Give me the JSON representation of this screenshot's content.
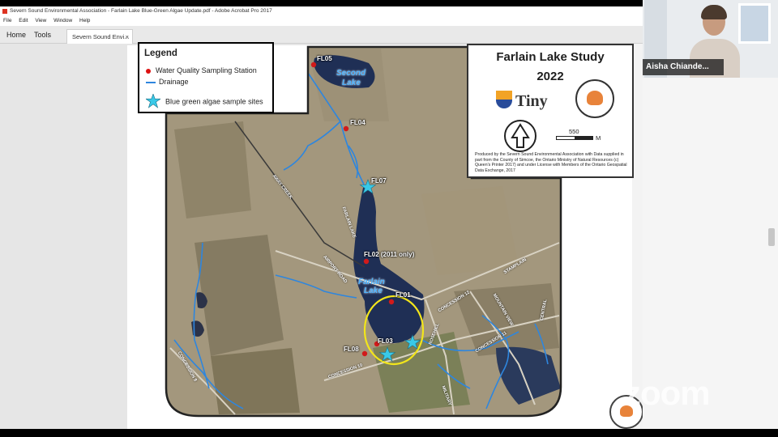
{
  "acrobat": {
    "title": "Severn Sound Environmental Association - Farlain Lake Blue-Green Algae Update.pdf - Adobe Acrobat Pro 2017",
    "menu": [
      "File",
      "Edit",
      "View",
      "Window",
      "Help"
    ],
    "nav": {
      "home": "Home",
      "tools": "Tools"
    },
    "doc_tab": {
      "label": "Severn Sound Envi...",
      "close": "×"
    }
  },
  "map": {
    "legend": {
      "title": "Legend",
      "items": [
        {
          "label": "Water Quality Sampling Station",
          "icon": "red-dot"
        },
        {
          "label": "Drainage",
          "icon": "blue-line"
        },
        {
          "label": "Blue green algae sample sites",
          "icon": "cyan-star"
        }
      ]
    },
    "study": {
      "title": "Farlain Lake Study",
      "year": "2022",
      "logo_text": "Tiny",
      "scale_value": "550",
      "scale_unit": "M",
      "credits": "Produced by the Severn Sound Environmental Association with Data supplied in part from the County of Simcoe, the Ontario Ministry of Natural Resources (c) Queen's Printer 2017) and under License with Members of the Ontario Geospatial Data Exchange, 2017"
    },
    "stations": {
      "fl05": "FL05",
      "fl04": "FL04",
      "fl07": "FL07",
      "fl02": "FL02 (2011 only)",
      "fl01": "FL01",
      "fl03": "FL03",
      "fl08": "FL08"
    },
    "lakes": {
      "second_1": "Second",
      "second_2": "Lake",
      "farlain_1": "Farlain",
      "farlain_2": "Lake"
    },
    "roads": {
      "r1": "AWAY CREEK",
      "r2": "FARLAIN LAKE",
      "r3": "AIRPORT ROAD",
      "r4": "CONCESSION 12",
      "r5": "STAMPLAIN",
      "r6": "CONCESSION 11",
      "r7": "MOUNTAIN VIEW",
      "r8": "CENTRAL",
      "r9": "CONCESSION 10",
      "r10": "MILITARY",
      "r11": "ROSEHILL",
      "r12": "CONCESSION 8"
    },
    "colors": {
      "station": "#d11a1a",
      "drainage": "#2e86de",
      "star": "#39c9e8",
      "ellipse": "#f2e51b"
    }
  },
  "zoom": {
    "participant_name": "Aisha Chiande...",
    "watermark": "zoom"
  }
}
